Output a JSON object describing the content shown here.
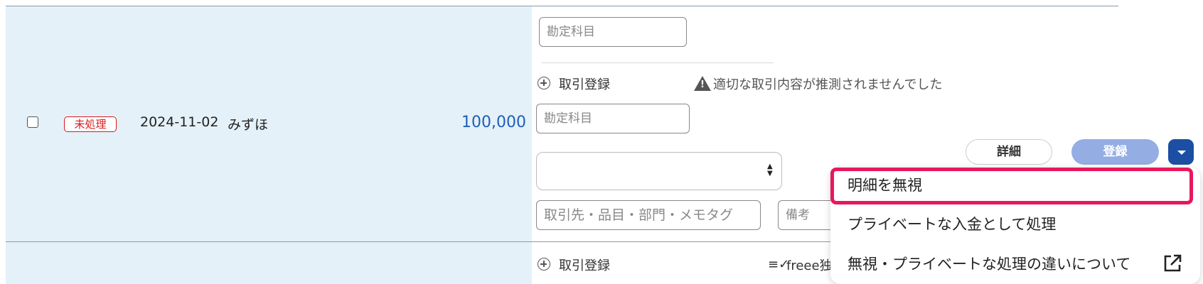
{
  "row": {
    "status": "未処理",
    "date": "2024-11-02",
    "bank": "みずほ",
    "amount": "100,000"
  },
  "form": {
    "account_placeholder_top": "勘定科目",
    "register_deal_label": "取引登録",
    "warning_text": "適切な取引内容が推測されませんでした",
    "account_placeholder": "勘定科目",
    "partner_placeholder": "取引先・品目・部門・メモタグ",
    "memo_placeholder": "備考"
  },
  "actions": {
    "detail": "詳細",
    "register": "登録"
  },
  "dropdown_menu": {
    "items": [
      "明細を無視",
      "プライベートな入金として処理",
      "無視・プライベートな処理の違いについて"
    ]
  },
  "next_row": {
    "register_deal_label": "取引登録",
    "filter_text": "freee独"
  },
  "colors": {
    "panel_bg": "#e4f1f8",
    "amount": "#1f5fb8",
    "status_badge": "#d81b1b",
    "register_button": "#94aee4",
    "dropdown_button": "#1c4fa3",
    "highlight": "#e8175d"
  },
  "icons": [
    "plus-circle-icon",
    "warning-icon",
    "select-arrows-icon",
    "caret-down-icon",
    "filter-check-icon",
    "external-link-icon"
  ]
}
